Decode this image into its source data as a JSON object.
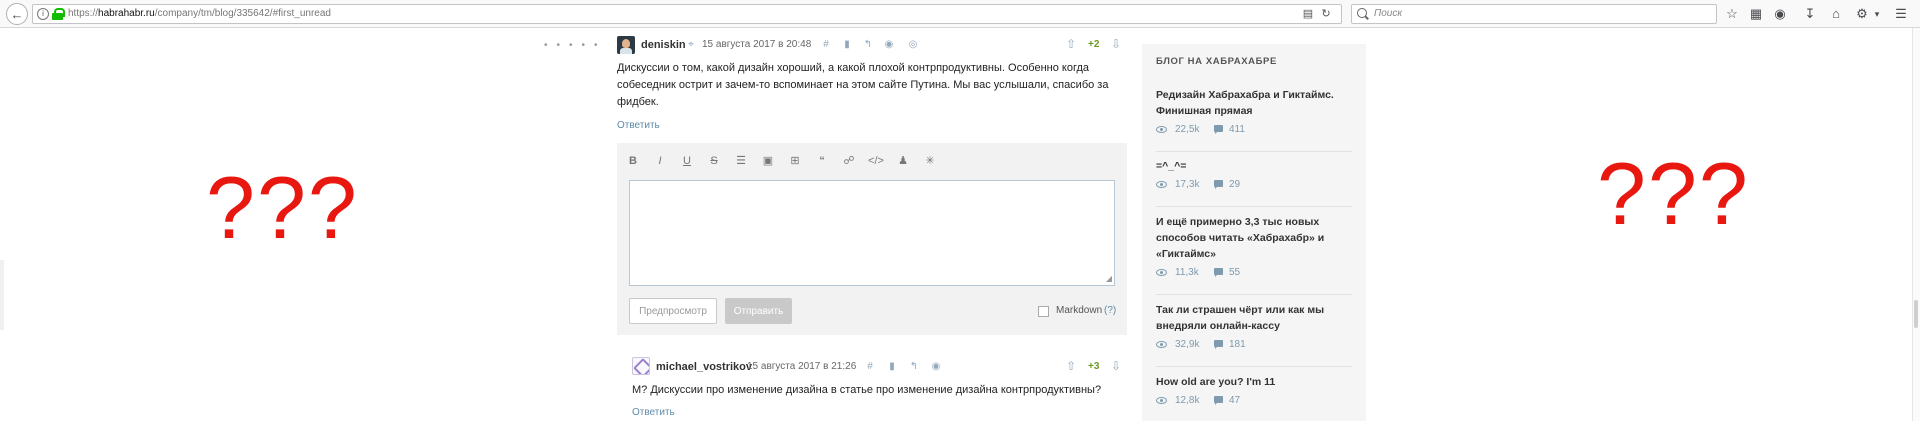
{
  "browser": {
    "url_prefix": "https://",
    "url_domain": "habrahabr.ru",
    "url_path": "/company/tm/blog/335642/#first_unread",
    "search_placeholder": "Поиск",
    "back_icon": "back-arrow-icon",
    "info_icon": "info-icon"
  },
  "placeholders": {
    "left": "???",
    "right": "???",
    "color": "#e8170f"
  },
  "comment1": {
    "username": "deniskin",
    "date": "15 августа 2017 в 20:48",
    "score": "+2",
    "text_lines": [
      "Дискуссии о том, какой дизайн хороший, а какой плохой контрпродуктивны. Особенно когда",
      "собеседник острит и зачем-то вспоминает на этом сайте Путина. Мы вас услышали, спасибо за",
      "фидбек."
    ],
    "reply": "Ответить",
    "score_color": "#6c9a1f"
  },
  "editor": {
    "tools": [
      "B",
      "I",
      "U",
      "S",
      "list",
      "image",
      "embed",
      "quote",
      "link",
      "code",
      "user",
      "spoiler"
    ],
    "preview_label": "Предпросмотр",
    "send_label": "Отправить",
    "markdown_label": "Markdown",
    "markdown_help": "(?)",
    "markdown_checked": false
  },
  "comment2": {
    "username": "michael_vostrikov",
    "date": "15 августа 2017 в 21:26",
    "score": "+3",
    "text": "М? Дискуссии про изменение дизайна в статье про изменение дизайна контрпродуктивны?",
    "reply": "Ответить"
  },
  "sidebar": {
    "title": "БЛОГ НА ХАБРАХАБРЕ",
    "items": [
      {
        "title_lines": [
          "Редизайн Хабрахабра и Гиктаймс.",
          "Финишная прямая"
        ],
        "views": "22,5k",
        "comments": "411"
      },
      {
        "title_lines": [
          "=^_^="
        ],
        "views": "17,3k",
        "comments": "29"
      },
      {
        "title_lines": [
          "И ещё примерно 3,3 тыс новых",
          "способов читать «Хабрахабр» и",
          "«Гиктаймс»"
        ],
        "views": "11,3k",
        "comments": "55"
      },
      {
        "title_lines": [
          "Так ли страшен чёрт или как мы",
          "внедряли онлайн-кассу"
        ],
        "views": "32,9k",
        "comments": "181"
      },
      {
        "title_lines": [
          "How old are you? I'm 11"
        ],
        "views": "12,8k",
        "comments": "47"
      }
    ]
  }
}
